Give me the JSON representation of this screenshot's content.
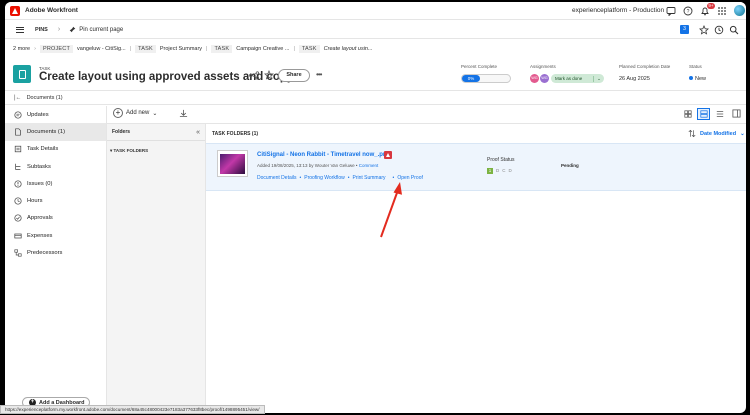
{
  "app": {
    "title": "Adobe Workfront",
    "environment": "experienceplatform - Production",
    "notification_count": "9+"
  },
  "pins": {
    "label": "PINS",
    "pin_current": "Pin current page",
    "count_badge": "3"
  },
  "breadcrumb": {
    "more": "2 more",
    "items": [
      {
        "tag": "PROJECT",
        "text": "vangeluw - CitiSig..."
      },
      {
        "tag": "TASK",
        "text": "Project Summary"
      },
      {
        "tag": "TASK",
        "text": "Campaign Creative ..."
      },
      {
        "tag": "TASK",
        "text": "Create layout usin..."
      }
    ]
  },
  "task": {
    "kicker": "TASK",
    "title": "Create layout using approved assets and copy",
    "share_label": "Share",
    "more_label": "•••",
    "percent_complete_label": "Percent Complete",
    "percent_complete_value": "0%",
    "assignments_label": "Assignments",
    "assignees": [
      {
        "initials": "WG",
        "color": "#e35a8f"
      },
      {
        "initials": "WG",
        "color": "#9a6fd1"
      }
    ],
    "mark_done_label": "Mark as done",
    "planned_label": "Planned Completion Date",
    "planned_value": "26 Aug 2025",
    "status_label": "Status",
    "status_value": "New"
  },
  "docbar": {
    "label": "Documents (1)"
  },
  "sidebar": {
    "items": [
      {
        "label": "Updates",
        "icon": "updates-icon"
      },
      {
        "label": "Documents (1)",
        "icon": "document-icon"
      },
      {
        "label": "Task Details",
        "icon": "details-icon"
      },
      {
        "label": "Subtasks",
        "icon": "subtasks-icon"
      },
      {
        "label": "Issues (0)",
        "icon": "issues-icon"
      },
      {
        "label": "Hours",
        "icon": "clock-icon"
      },
      {
        "label": "Approvals",
        "icon": "approval-icon"
      },
      {
        "label": "Expenses",
        "icon": "expenses-icon"
      },
      {
        "label": "Predecessors",
        "icon": "predecessors-icon"
      }
    ],
    "add_dashboard": "Add a Dashboard"
  },
  "toolbar": {
    "add_new": "Add new"
  },
  "folders": {
    "header": "Folders",
    "collapse": "«",
    "item": "TASK FOLDERS"
  },
  "documents": {
    "header": "TASK FOLDERS (1)",
    "sort_label": "Date Modified",
    "row": {
      "name": "CitiSignal - Neon Rabbit - Timetravel now_.png",
      "added": "Added 19/08/2025, 13:13 by Wouter Van Geluwe",
      "comment": "Comment",
      "links": [
        "Document Details",
        "Proofing Workflow",
        "Print Summary"
      ],
      "open_proof": "Open Proof",
      "proof_status_label": "Proof Status",
      "proof_steps": [
        "1",
        "D",
        "C",
        "D"
      ],
      "pending": "Pending"
    }
  },
  "status_url": "https://experienceplatform.my.workfront.adobe.com/document/68a45c48000423e7183a377633f8bec/proof/1498895451/view/"
}
